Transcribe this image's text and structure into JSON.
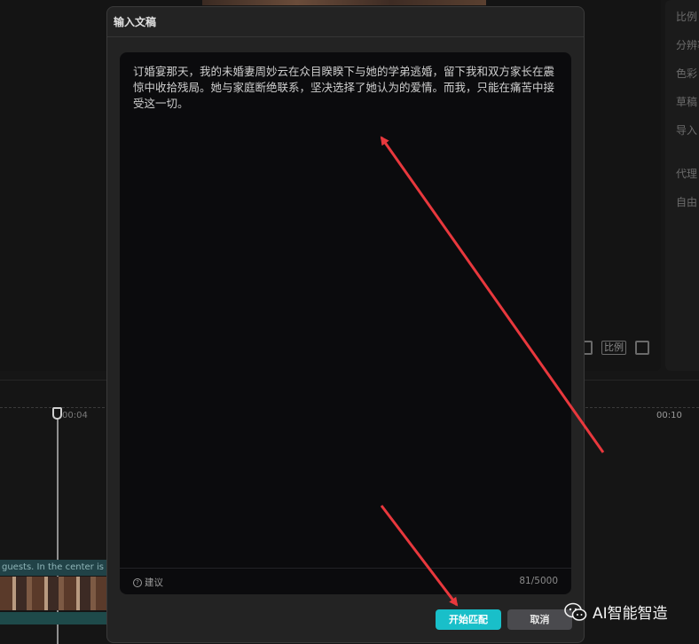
{
  "dialog": {
    "title": "输入文稿",
    "content": "订婚宴那天，我的未婚妻周妙云在众目睽睽下与她的学弟逃婚，留下我和双方家长在震惊中收拾残局。她与家庭断绝联系，坚决选择了她认为的爱情。而我，只能在痛苦中接受这一切。",
    "suggest_label": "建议",
    "counter": "81/5000",
    "primary_button": "开始匹配",
    "cancel_button": "取消"
  },
  "background": {
    "right_panel_items": [
      "比例",
      "分辨率",
      "色彩",
      "草稿",
      "导入",
      "代理",
      "自由"
    ],
    "ratio_label": "比例",
    "timeline_time_left": "00:04",
    "timeline_time_right": "00:10",
    "caption_track_text": "guests. In the center is a v"
  },
  "watermark": {
    "text": "AI智能智造",
    "icon": "wechat-icon"
  },
  "colors": {
    "accent": "#19bfc9",
    "arrow": "#e8383d"
  }
}
